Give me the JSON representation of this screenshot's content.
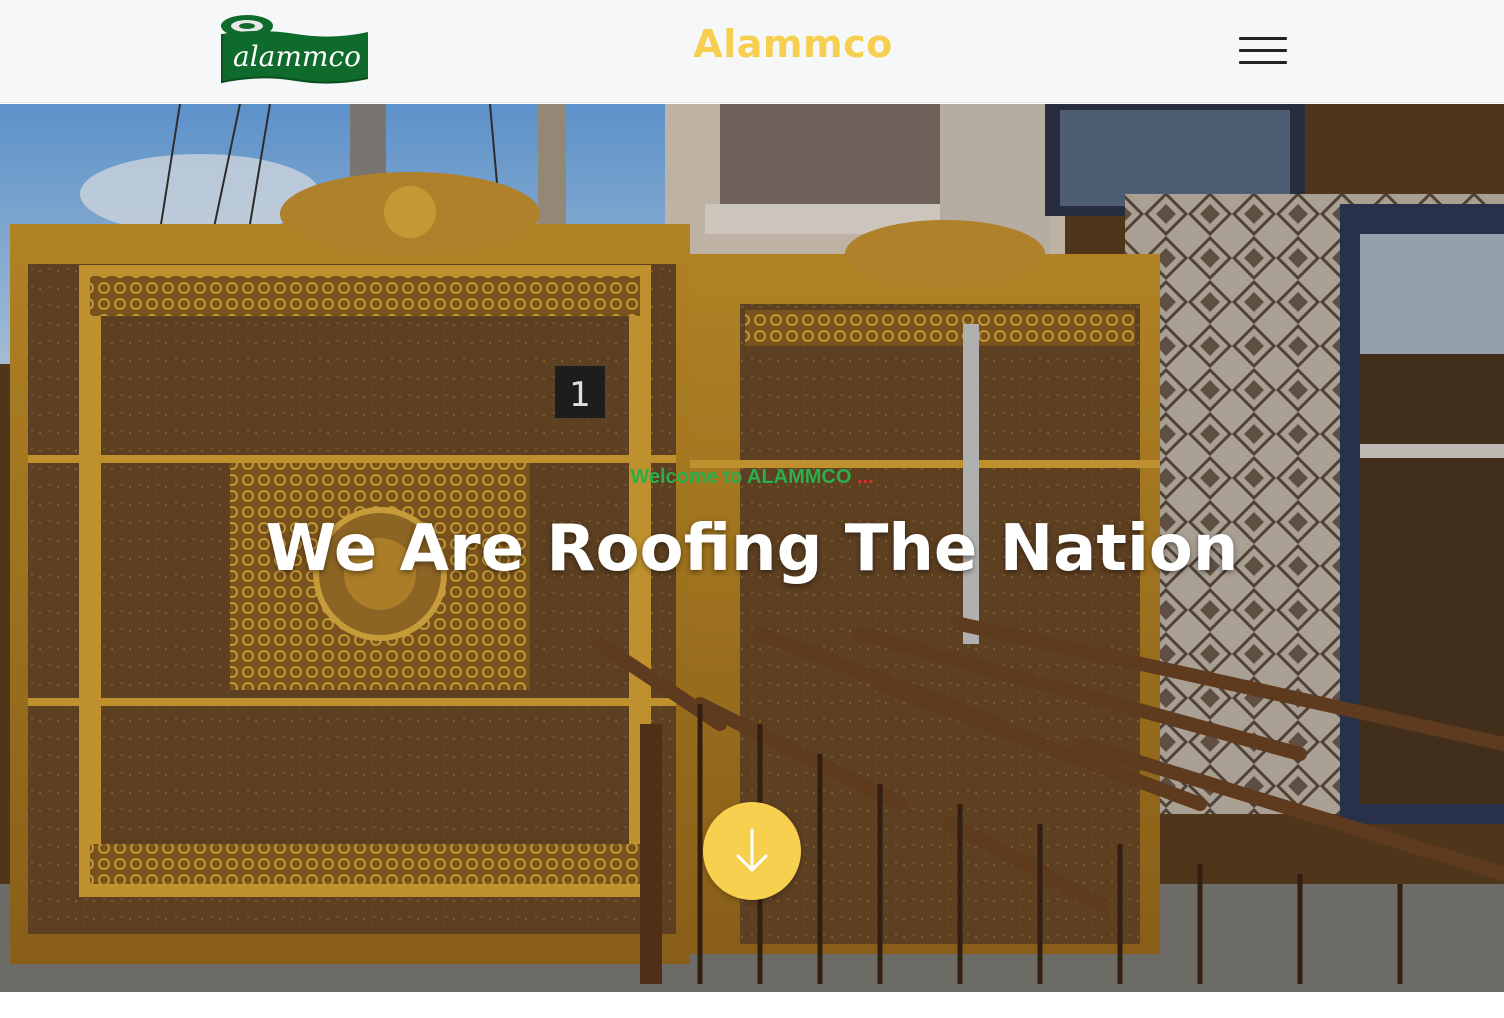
{
  "header": {
    "logo_text": "alammco",
    "brand_title": "Alammco",
    "menu_icon": "hamburger-menu-icon"
  },
  "hero": {
    "welcome_prefix": "Welcome to ALAMMCO",
    "welcome_suffix": "...",
    "title": "We Are Roofing The Nation",
    "gate_number": "1",
    "scroll_icon": "arrow-down-icon"
  },
  "colors": {
    "brand_yellow": "#f7cf4e",
    "logo_green": "#0f6b2b",
    "welcome_green": "#2cae4d",
    "welcome_red": "#e0302b",
    "header_bg": "#f6f7f8"
  }
}
